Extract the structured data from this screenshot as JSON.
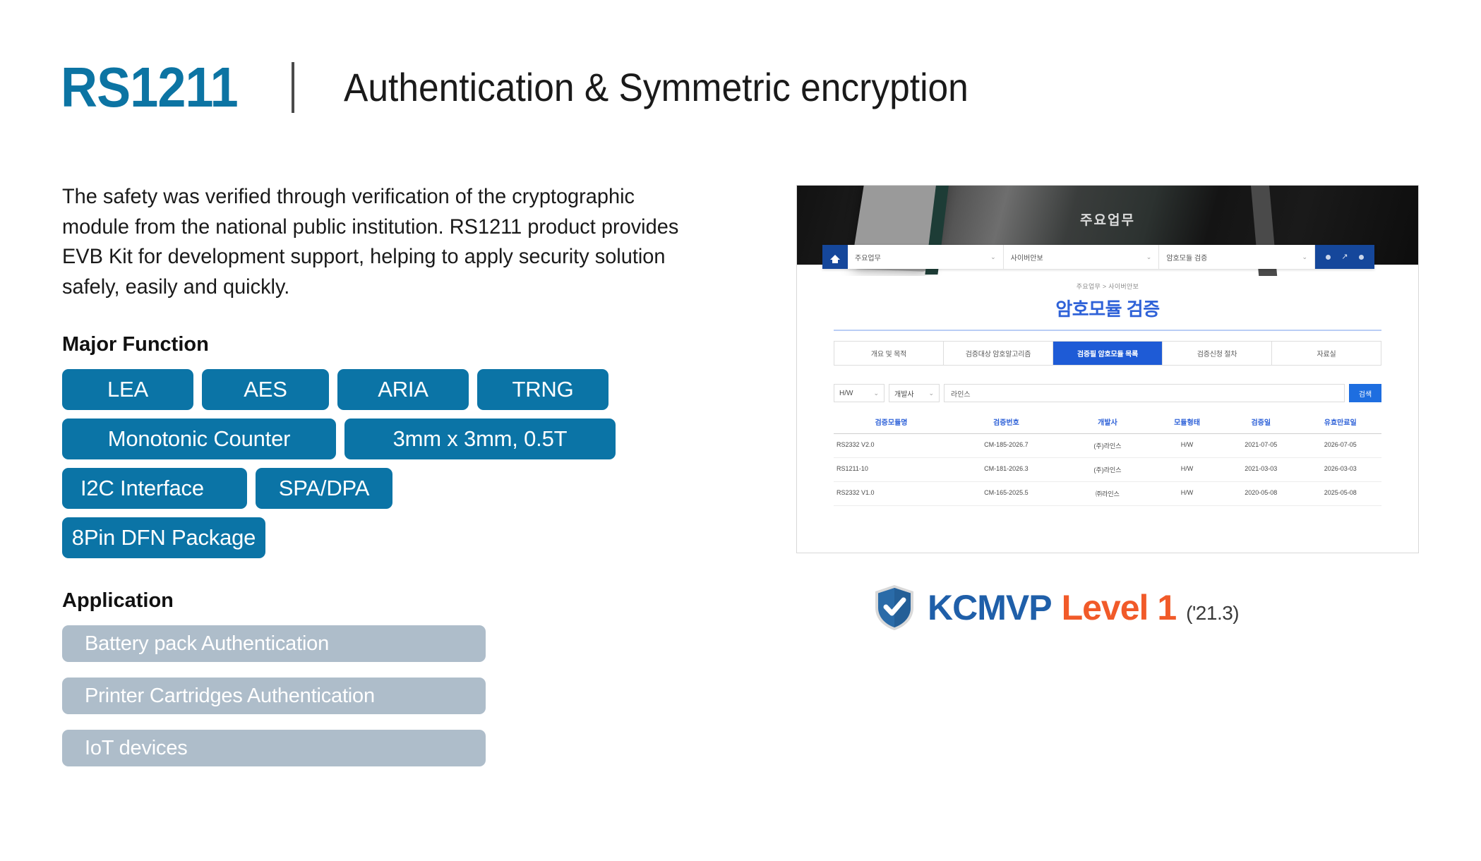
{
  "header": {
    "product": "RS1211",
    "subtitle": "Authentication & Symmetric encryption"
  },
  "intro": {
    "body": "The safety was verified through verification of the cryptographic module from the national public institution. RS1211 product provides EVB Kit for development support, helping to apply security solution safely, easily and quickly."
  },
  "major_function": {
    "heading": "Major Function",
    "rows": [
      [
        "LEA",
        "AES",
        "ARIA",
        "TRNG"
      ],
      [
        "Monotonic Counter",
        "3mm x 3mm, 0.5T"
      ],
      [
        "I2C Interface",
        "SPA/DPA"
      ],
      [
        "8Pin DFN Package"
      ]
    ]
  },
  "application": {
    "heading": "Application",
    "items": [
      "Battery pack Authentication",
      "Printer Cartridges Authentication",
      "IoT devices"
    ]
  },
  "screenshot": {
    "hero_label": "주요업무",
    "nav": {
      "select1": "주요업무",
      "select2": "사이버안보",
      "select3": "암호모듈 검증",
      "caret": "⌄"
    },
    "breadcrumb": "주요업무 > 사이버안보",
    "page_title": "암호모듈 검증",
    "tabs": [
      {
        "label": "개요 및 목적",
        "active": false
      },
      {
        "label": "검증대상 암호알고리즘",
        "active": false
      },
      {
        "label": "검증필 암호모듈 목록",
        "active": true
      },
      {
        "label": "검증신청 절차",
        "active": false
      },
      {
        "label": "자료실",
        "active": false
      }
    ],
    "filters": {
      "type": "H/W",
      "developer": "개발사",
      "search_value": "라인스",
      "search_button": "검색"
    },
    "table": {
      "columns": [
        "검증모듈명",
        "검증번호",
        "개발사",
        "모듈형태",
        "검증일",
        "유효만료일"
      ],
      "rows": [
        [
          "RS2332 V2.0",
          "CM-185-2026.7",
          "(주)라인스",
          "H/W",
          "2021-07-05",
          "2026-07-05"
        ],
        [
          "RS1211-10",
          "CM-181-2026.3",
          "(주)라인스",
          "H/W",
          "2021-03-03",
          "2026-03-03"
        ],
        [
          "RS2332 V1.0",
          "CM-165-2025.5",
          "㈜라인스",
          "H/W",
          "2020-05-08",
          "2025-05-08"
        ]
      ]
    }
  },
  "kcmvp": {
    "name": "KCMVP",
    "level": "Level 1",
    "date": "('21.3)"
  },
  "colors": {
    "brand_blue": "#0c74a3",
    "chip_blue": "#0b74a6",
    "app_gray": "#aebdca",
    "kcmvp_blue": "#1f5fa9",
    "kcmvp_orange": "#f15a29",
    "nav_navy": "#15479b",
    "tab_active": "#1e5bd6"
  }
}
